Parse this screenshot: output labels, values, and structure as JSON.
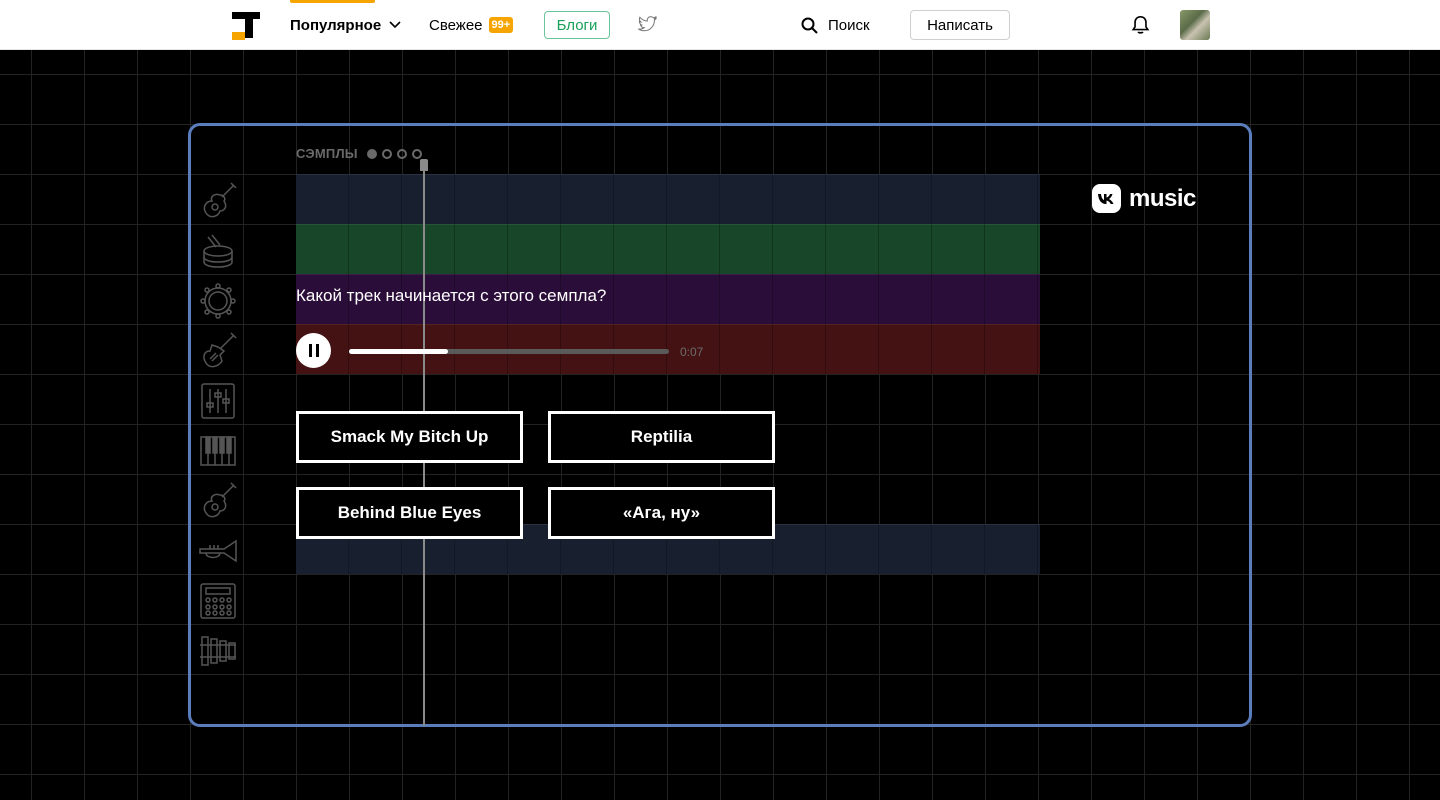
{
  "header": {
    "nav": {
      "popular_label": "Популярное",
      "fresh_label": "Свежее",
      "fresh_badge": "99+",
      "blogs_label": "Блоги"
    },
    "search_label": "Поиск",
    "write_label": "Написать"
  },
  "quiz": {
    "samples_label": "СЭМПЛЫ",
    "samples_progress": {
      "current": 1,
      "total": 4
    },
    "brand": "music",
    "question": "Какой трек начинается с этого семпла?",
    "player": {
      "time": "0:07",
      "progress_fraction": 0.31
    },
    "answers": [
      "Smack My Bitch Up",
      "Reptilia",
      "Behind Blue Eyes",
      "«Ага, ну»"
    ],
    "instruments": [
      "acoustic-guitar-icon",
      "drum-icon",
      "tambourine-icon",
      "electric-guitar-icon",
      "mixer-icon",
      "piano-icon",
      "bass-guitar-icon",
      "trumpet-icon",
      "drum-pad-icon",
      "xylophone-icon"
    ]
  },
  "colors": {
    "accent": "#f5a400",
    "panel_border": "#5b7dbb",
    "blogs_green": "#18a058"
  }
}
